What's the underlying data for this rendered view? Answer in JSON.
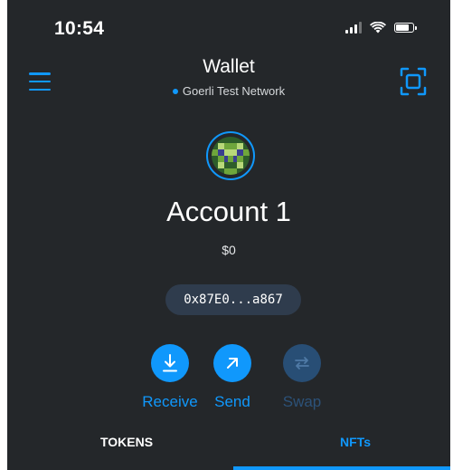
{
  "status_bar": {
    "time": "10:54"
  },
  "header": {
    "title": "Wallet",
    "network": "Goerli Test Network"
  },
  "account": {
    "name": "Account 1",
    "balance": "$0",
    "address": "0x87E0...a867"
  },
  "actions": [
    {
      "label": "Receive",
      "icon": "arrow-down-icon",
      "enabled": true
    },
    {
      "label": "Send",
      "icon": "arrow-up-right-icon",
      "enabled": true
    },
    {
      "label": "Swap",
      "icon": "swap-icon",
      "enabled": false
    }
  ],
  "tabs": [
    {
      "label": "TOKENS",
      "active": false
    },
    {
      "label": "NFTs",
      "active": true
    }
  ],
  "colors": {
    "background": "#24272a",
    "accent": "#1098fc",
    "address_pill": "#2f3c4d",
    "disabled": "#284e75"
  }
}
